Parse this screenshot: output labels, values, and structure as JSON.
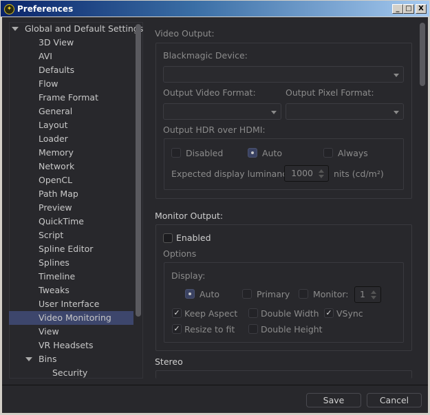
{
  "window": {
    "title": "Preferences",
    "minimize": "_",
    "maximize": "□",
    "close": "X"
  },
  "tree": {
    "root": "Global and Default Settings",
    "items": [
      "3D View",
      "AVI",
      "Defaults",
      "Flow",
      "Frame Format",
      "General",
      "Layout",
      "Loader",
      "Memory",
      "Network",
      "OpenCL",
      "Path Map",
      "Preview",
      "QuickTime",
      "Script",
      "Spline Editor",
      "Splines",
      "Timeline",
      "Tweaks",
      "User Interface",
      "Video Monitoring",
      "View",
      "VR Headsets"
    ],
    "selected": "Video Monitoring",
    "bins": "Bins",
    "bins_children": [
      "Security"
    ]
  },
  "video_output": {
    "title": "Video Output:",
    "device_label": "Blackmagic Device:",
    "device_value": "",
    "video_format_label": "Output Video Format:",
    "video_format_value": "",
    "pixel_format_label": "Output Pixel Format:",
    "pixel_format_value": "",
    "hdr_label": "Output HDR over HDMI:",
    "hdr_options": [
      "Disabled",
      "Auto",
      "Always"
    ],
    "hdr_selected": "Auto",
    "luminance_label": "Expected display luminance:",
    "luminance_value": "1000",
    "luminance_unit": "nits (cd/m²)"
  },
  "monitor_output": {
    "title": "Monitor Output:",
    "enabled_label": "Enabled",
    "enabled": false,
    "options_label": "Options",
    "display_label": "Display:",
    "display_options": [
      "Auto",
      "Primary",
      "Monitor:"
    ],
    "display_selected": "Auto",
    "monitor_value": "1",
    "keep_aspect": "Keep Aspect",
    "keep_aspect_checked": true,
    "double_width": "Double Width",
    "double_width_checked": false,
    "vsync": "VSync",
    "vsync_checked": true,
    "resize_to_fit": "Resize to fit",
    "resize_to_fit_checked": true,
    "double_height": "Double Height",
    "double_height_checked": false
  },
  "stereo": {
    "title": "Stereo"
  },
  "footer": {
    "save": "Save",
    "cancel": "Cancel"
  }
}
